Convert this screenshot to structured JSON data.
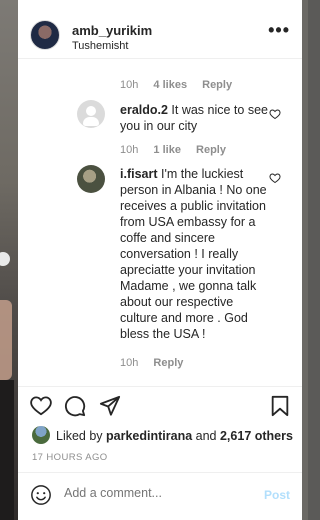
{
  "colors": {
    "link_blue_disabled": "#b2dffc",
    "meta_grey": "#8e8e8e",
    "text": "#262626"
  },
  "header": {
    "username": "amb_yurikim",
    "location": "Tushemisht",
    "more": "•••"
  },
  "top_meta": {
    "time": "10h",
    "likes": "4 likes",
    "reply": "Reply"
  },
  "comments": [
    {
      "user": "eraldo.2",
      "text": " It was nice to see you in our city",
      "time": "10h",
      "likes": "1 like",
      "reply": "Reply"
    },
    {
      "user": "i.fisart",
      "text": " I'm the luckiest person in Albania ! No one receives a public invitation from USA embassy for a coffe and sincere conversation ! I really apreciatte your invitation Madame , we gonna talk about our respective culture and more . God bless the USA !",
      "time": "10h",
      "reply": "Reply"
    }
  ],
  "liked_by": {
    "prefix": "Liked by ",
    "user": "parkedintirana",
    "joiner": " and ",
    "others": "2,617 others"
  },
  "timestamp": "17 HOURS AGO",
  "add_comment": {
    "placeholder": "Add a comment...",
    "post_label": "Post"
  },
  "icons": [
    "heart-icon",
    "comment-icon",
    "share-icon",
    "bookmark-icon",
    "emoji-icon",
    "more-icon"
  ]
}
